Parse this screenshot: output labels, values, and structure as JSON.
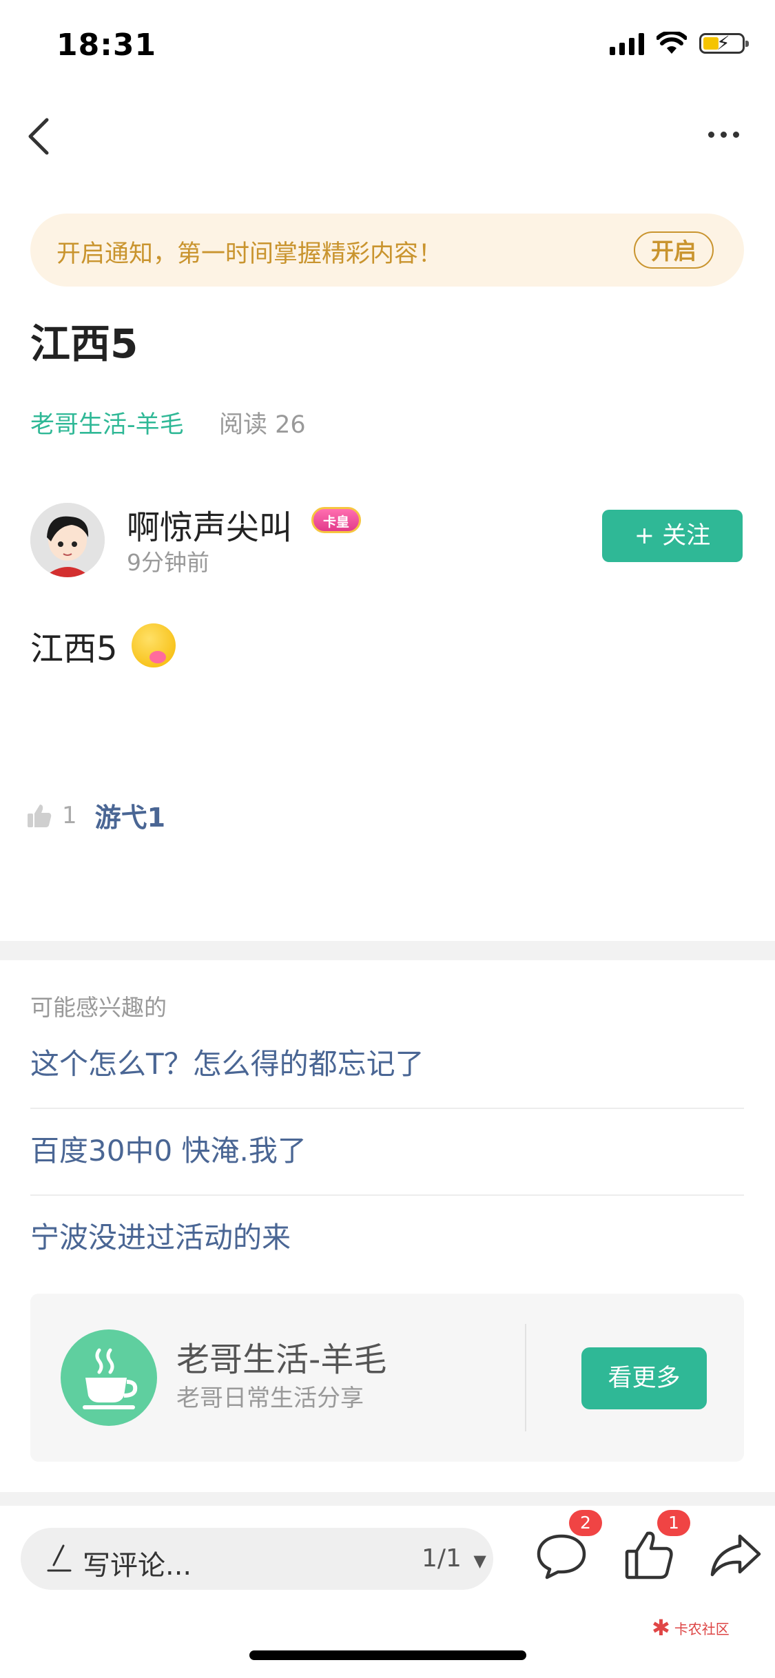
{
  "status": {
    "time": "18:31"
  },
  "notify": {
    "text": "开启通知，第一时间掌握精彩内容！",
    "button": "开启"
  },
  "post": {
    "title": "江西5",
    "category": "老哥生活-羊毛",
    "read": "阅读 26",
    "body": "江西5"
  },
  "author": {
    "name": "啊惊声尖叫",
    "badge": "卡皇",
    "time": "9分钟前",
    "follow_label": "+ 关注"
  },
  "likes": {
    "count": "1",
    "user": "游弋1"
  },
  "recommend": {
    "label": "可能感兴趣的",
    "items": [
      "这个怎么T？怎么得的都忘记了",
      "百度30中0 快淹.我了",
      "宁波没进过活动的来"
    ]
  },
  "channel": {
    "name": "老哥生活-羊毛",
    "desc": "老哥日常生活分享",
    "button": "看更多"
  },
  "bottom": {
    "comment_placeholder": "写评论...",
    "pager": "1/1",
    "comment_badge": "2",
    "like_badge": "1",
    "watermark": "卡农社区"
  },
  "colors": {
    "accent": "#2fb896",
    "link": "#4a6694",
    "notify_bg": "#fdf3e4",
    "notify_text": "#c9942e",
    "badge": "#f04444"
  }
}
